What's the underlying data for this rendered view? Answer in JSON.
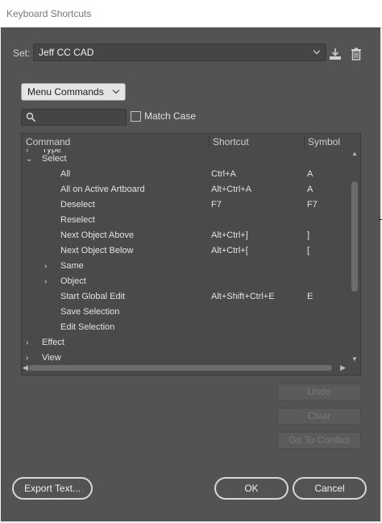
{
  "window": {
    "title": "Keyboard Shortcuts"
  },
  "set": {
    "label": "Set:",
    "value": "Jeff CC CAD"
  },
  "icons": {
    "save_set": "save-set-icon",
    "delete_set": "trash-icon",
    "search": "search-icon"
  },
  "category": {
    "value": "Menu Commands"
  },
  "search": {
    "placeholder": ""
  },
  "match_case": {
    "label": "Match Case",
    "checked": false
  },
  "table": {
    "headers": {
      "command": "Command",
      "shortcut": "Shortcut",
      "symbol": "Symbol"
    },
    "rows": [
      {
        "indent": 0,
        "arrow": "›",
        "command": "Type",
        "shortcut": "",
        "symbol": "",
        "partial": true
      },
      {
        "indent": 0,
        "arrow": "⌄",
        "command": "Select",
        "shortcut": "",
        "symbol": ""
      },
      {
        "indent": 2,
        "arrow": "",
        "command": "All",
        "shortcut": "Ctrl+A",
        "symbol": "A"
      },
      {
        "indent": 2,
        "arrow": "",
        "command": "All on Active Artboard",
        "shortcut": "Alt+Ctrl+A",
        "symbol": "A"
      },
      {
        "indent": 2,
        "arrow": "",
        "command": "Deselect",
        "shortcut": "F7",
        "symbol": "F7"
      },
      {
        "indent": 2,
        "arrow": "",
        "command": "Reselect",
        "shortcut": "",
        "symbol": ""
      },
      {
        "indent": 2,
        "arrow": "",
        "command": "Next Object Above",
        "shortcut": "Alt+Ctrl+]",
        "symbol": "]"
      },
      {
        "indent": 2,
        "arrow": "",
        "command": "Next Object Below",
        "shortcut": "Alt+Ctrl+[",
        "symbol": "["
      },
      {
        "indent": 1,
        "arrow": "›",
        "command": "Same",
        "shortcut": "",
        "symbol": ""
      },
      {
        "indent": 1,
        "arrow": "›",
        "command": "Object",
        "shortcut": "",
        "symbol": ""
      },
      {
        "indent": 2,
        "arrow": "",
        "command": "Start Global Edit",
        "shortcut": "Alt+Shift+Ctrl+E",
        "symbol": "E"
      },
      {
        "indent": 2,
        "arrow": "",
        "command": "Save Selection",
        "shortcut": "",
        "symbol": ""
      },
      {
        "indent": 2,
        "arrow": "",
        "command": "Edit Selection",
        "shortcut": "",
        "symbol": ""
      },
      {
        "indent": 0,
        "arrow": "›",
        "command": "Effect",
        "shortcut": "",
        "symbol": ""
      },
      {
        "indent": 0,
        "arrow": "›",
        "command": "View",
        "shortcut": "",
        "symbol": ""
      }
    ]
  },
  "buttons": {
    "undo": "Undo",
    "clear": "Clear",
    "go_to_conflict": "Go To Conflict",
    "export_text": "Export Text...",
    "ok": "OK",
    "cancel": "Cancel"
  },
  "colors": {
    "panel": "#535353",
    "field": "#454545",
    "table": "#4a4a4a",
    "text": "#e2e2e2",
    "disabled_text": "#7a7a7a"
  }
}
